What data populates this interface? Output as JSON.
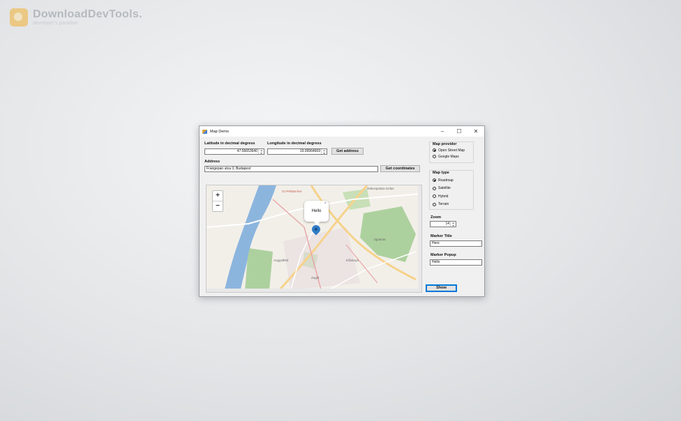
{
  "watermark": {
    "title": "DownloadDevTools.",
    "subtitle": "developer's paradise"
  },
  "window": {
    "title": "Map Demo",
    "controls": {
      "minimize": "–",
      "maximize": "☐",
      "close": "✕"
    }
  },
  "form": {
    "latitude_label": "Latitude in decimal degress",
    "latitude_value": "47.56653640",
    "longitude_label": "Longitude in decimal degress",
    "longitude_value": "19.09964669",
    "get_address_label": "Get address",
    "address_label": "Address",
    "address_value": "Frangepan utca 3, Budapest",
    "get_coordinates_label": "Get coordinates"
  },
  "map": {
    "zoom_in": "+",
    "zoom_out": "−",
    "popup_text": "Hello",
    "popup_close": "×",
    "labels": [
      "ÚJ-Palotai ker.",
      "Rákospalota-Szilas",
      "Angyalföld",
      "Újpalota",
      "Kőbánya",
      "Zugló"
    ]
  },
  "sidebar": {
    "provider_title": "Map provider",
    "providers": [
      {
        "label": "Open Street Map",
        "selected": true
      },
      {
        "label": "Google Maps",
        "selected": false
      }
    ],
    "type_title": "Map type",
    "types": [
      {
        "label": "Roadmap",
        "selected": true
      },
      {
        "label": "Satellite",
        "selected": false
      },
      {
        "label": "Hybrid",
        "selected": false
      },
      {
        "label": "Terrain",
        "selected": false
      }
    ],
    "zoom_label": "Zoom",
    "zoom_value": "14",
    "marker_title_label": "Marker Title",
    "marker_title_value": "Here",
    "marker_popup_label": "Marker Popup",
    "marker_popup_value": "Hello",
    "show_label": "Show"
  },
  "colors": {
    "map_land": "#f2efe9",
    "river": "#8cb5de",
    "park": "#add19e",
    "road_major": "#f6d28a",
    "marker": "#2f7bc7"
  }
}
